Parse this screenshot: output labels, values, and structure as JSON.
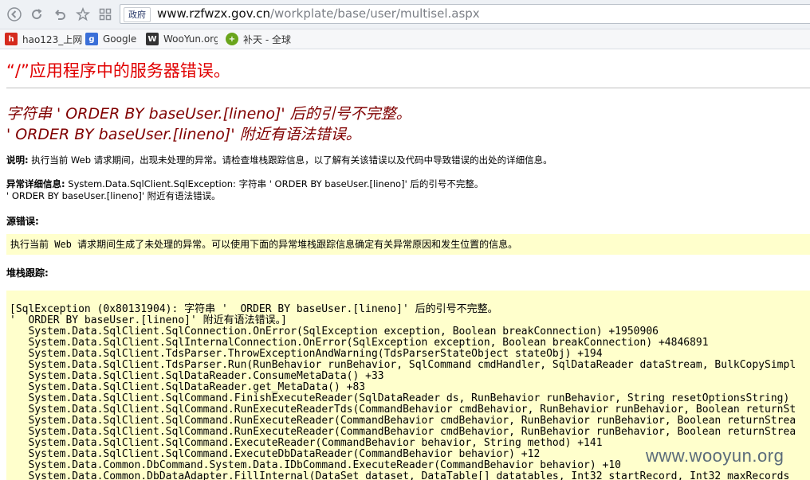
{
  "browser": {
    "address_badge": "政府",
    "url_host": "www.rzfwzx.gov.cn",
    "url_path": "/workplate/base/user/multisel.aspx",
    "nav_icons": [
      "back-icon",
      "refresh-icon",
      "undo-icon",
      "star-icon",
      "grid-icon"
    ],
    "bookmarks": [
      {
        "label": "hao123_上网",
        "icon": "hao123-icon",
        "color": "#d52b1e"
      },
      {
        "label": "Google",
        "icon": "google-icon",
        "color": "#3a6fd8"
      },
      {
        "label": "WooYun.org",
        "icon": "wooyun-icon",
        "color": "#333333"
      },
      {
        "label": "补天 - 全球",
        "icon": "butian-icon",
        "color": "#6aa51c"
      }
    ]
  },
  "page": {
    "title": "“/”应用程序中的服务器错误。",
    "error_line1": "字符串 '  ORDER BY baseUser.[lineno]' 后的引号不完整。",
    "error_line2": "'  ORDER BY baseUser.[lineno]' 附近有语法错误。",
    "desc_label": "说明:",
    "desc_text": " 执行当前 Web 请求期间，出现未处理的异常。请检查堆栈跟踪信息，以了解有关该错误以及代码中导致错误的出处的详细信息。",
    "detail_label": "异常详细信息:",
    "detail_text": " System.Data.SqlClient.SqlException: 字符串 '  ORDER BY baseUser.[lineno]' 后的引号不完整。",
    "detail_text2": "'  ORDER BY baseUser.[lineno]' 附近有语法错误。",
    "source_label": "源错误:",
    "source_text": "执行当前 Web 请求期间生成了未处理的异常。可以使用下面的异常堆栈跟踪信息确定有关异常原因和发生位置的信息。",
    "stack_label": "堆栈跟踪:",
    "stack_trace": "[SqlException (0x80131904): 字符串 '  ORDER BY baseUser.[lineno]' 后的引号不完整。\n'  ORDER BY baseUser.[lineno]' 附近有语法错误。]\n   System.Data.SqlClient.SqlConnection.OnError(SqlException exception, Boolean breakConnection) +1950906\n   System.Data.SqlClient.SqlInternalConnection.OnError(SqlException exception, Boolean breakConnection) +4846891\n   System.Data.SqlClient.TdsParser.ThrowExceptionAndWarning(TdsParserStateObject stateObj) +194\n   System.Data.SqlClient.TdsParser.Run(RunBehavior runBehavior, SqlCommand cmdHandler, SqlDataReader dataStream, BulkCopySimpl\n   System.Data.SqlClient.SqlDataReader.ConsumeMetaData() +33\n   System.Data.SqlClient.SqlDataReader.get_MetaData() +83\n   System.Data.SqlClient.SqlCommand.FinishExecuteReader(SqlDataReader ds, RunBehavior runBehavior, String resetOptionsString)\n   System.Data.SqlClient.SqlCommand.RunExecuteReaderTds(CommandBehavior cmdBehavior, RunBehavior runBehavior, Boolean returnSt\n   System.Data.SqlClient.SqlCommand.RunExecuteReader(CommandBehavior cmdBehavior, RunBehavior runBehavior, Boolean returnStrea\n   System.Data.SqlClient.SqlCommand.RunExecuteReader(CommandBehavior cmdBehavior, RunBehavior runBehavior, Boolean returnStrea\n   System.Data.SqlClient.SqlCommand.ExecuteReader(CommandBehavior behavior, String method) +141\n   System.Data.SqlClient.SqlCommand.ExecuteDbDataReader(CommandBehavior behavior) +12\n   System.Data.Common.DbCommand.System.Data.IDbCommand.ExecuteReader(CommandBehavior behavior) +10\n   System.Data.Common.DbDataAdapter.FillInternal(DataSet dataset, DataTable[] datatables, Int32 startRecord, Int32 maxRecords",
    "watermark": "www.wooyun.org"
  },
  "colors": {
    "title_red": "#e00000",
    "error_maroon": "#800000",
    "code_bg": "#ffffcc"
  }
}
